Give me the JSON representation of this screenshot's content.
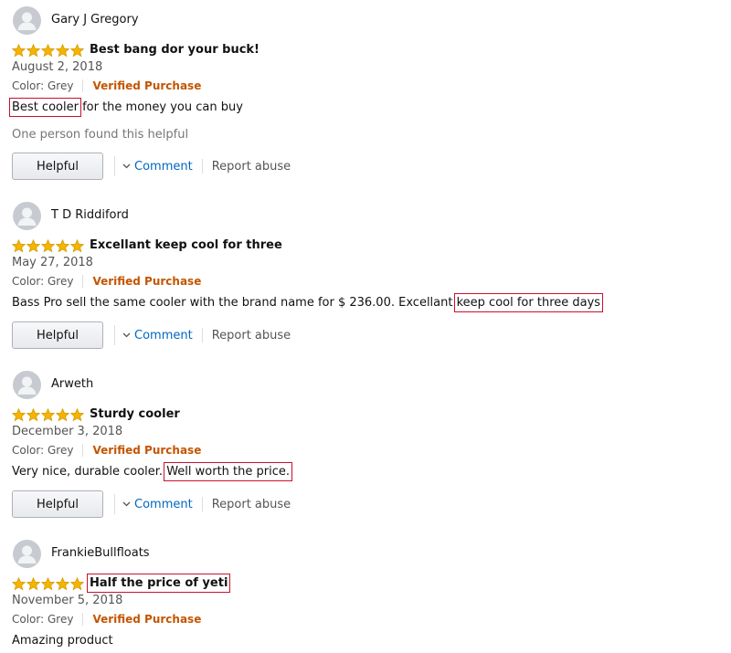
{
  "reviews": [
    {
      "author": "Gary J Gregory",
      "rating": 5,
      "title": "Best bang dor your buck!",
      "date": "August 2, 2018",
      "color": "Color: Grey",
      "verified": "Verified Purchase",
      "body_highlight": "Best cooler",
      "body_rest": " for the money you can buy",
      "helpful_count": "One person found this helpful",
      "helpful_label": "Helpful",
      "comment_label": "Comment",
      "report_label": "Report abuse"
    },
    {
      "author": "T D Riddiford",
      "rating": 5,
      "title": "Excellant keep cool for three",
      "date": "May 27, 2018",
      "color": "Color: Grey",
      "verified": "Verified Purchase",
      "body_pre": "Bass Pro sell the same cooler with the brand name for $ 236.00. Excellant ",
      "body_highlight": "keep cool for three days",
      "helpful_label": "Helpful",
      "comment_label": "Comment",
      "report_label": "Report abuse"
    },
    {
      "author": "Arweth",
      "rating": 5,
      "title": "Sturdy cooler",
      "date": "December 3, 2018",
      "color": "Color: Grey",
      "verified": "Verified Purchase",
      "body_pre": "Very nice, durable cooler. ",
      "body_highlight": "Well worth the price.",
      "helpful_label": "Helpful",
      "comment_label": "Comment",
      "report_label": "Report abuse"
    },
    {
      "author": "FrankieBullfloats",
      "rating": 5,
      "title": "Half the price of yeti",
      "date": "November 5, 2018",
      "color": "Color: Grey",
      "verified": "Verified Purchase",
      "body": "Amazing product"
    }
  ],
  "colors": {
    "star": "#f4b400",
    "verified": "#c45500",
    "link": "#0066c0",
    "highlight_box": "#c8102e"
  }
}
